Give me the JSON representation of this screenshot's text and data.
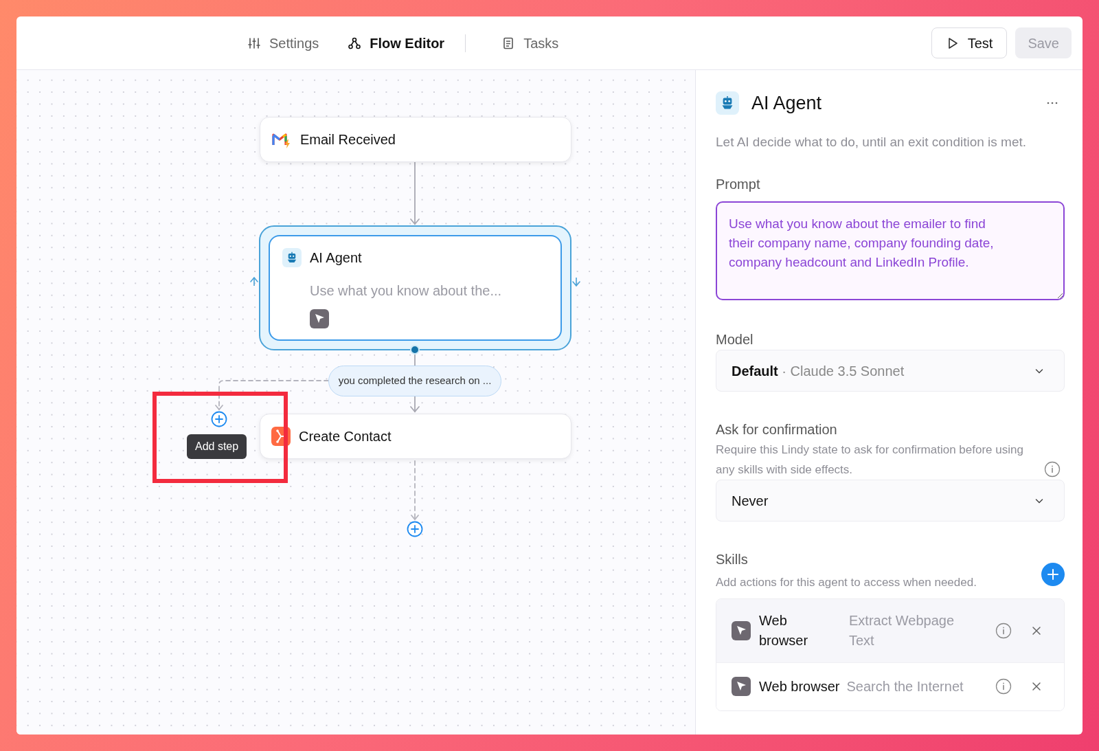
{
  "header": {
    "tabs": [
      {
        "label": "Settings",
        "selected": false
      },
      {
        "label": "Flow Editor",
        "selected": true
      },
      {
        "label": "Tasks",
        "selected": false
      }
    ],
    "buttons": [
      {
        "label": "Test",
        "disabled": false
      },
      {
        "label": "Save",
        "disabled": true
      }
    ]
  },
  "canvas": {
    "nodes": [
      {
        "kind": "trigger",
        "title": "Email Received",
        "selected": false
      },
      {
        "kind": "agent",
        "title": "AI Agent",
        "subtitle": "Use what you know about the...",
        "selected": true
      },
      {
        "kind": "action",
        "title": "Create Contact",
        "selected": false
      }
    ],
    "condition": "you completed the research on ...",
    "tooltip": "Add step"
  },
  "panel": {
    "title": "AI Agent",
    "description": "Let AI decide what to do, until an exit condition is met.",
    "prompt": {
      "label": "Prompt",
      "value": "Use what you know about the emailer to find their company name, company founding date, company headcount and LinkedIn Profile."
    },
    "model": {
      "label": "Model",
      "value": "**Default** · Claude 3.5 Sonnet"
    },
    "confirmation": {
      "label": "Ask for confirmation",
      "description": "Require this Lindy state to ask for confirmation before using any skills with side effects.",
      "value": "Never"
    },
    "skills": {
      "label": "Skills",
      "description": "Add actions for this agent to access when needed.",
      "items": [
        {
          "name": "Web browser",
          "action": "Extract Webpage Text",
          "hovered": true
        },
        {
          "name": "Web browser",
          "action": "Search the Internet",
          "hovered": false
        }
      ]
    }
  }
}
